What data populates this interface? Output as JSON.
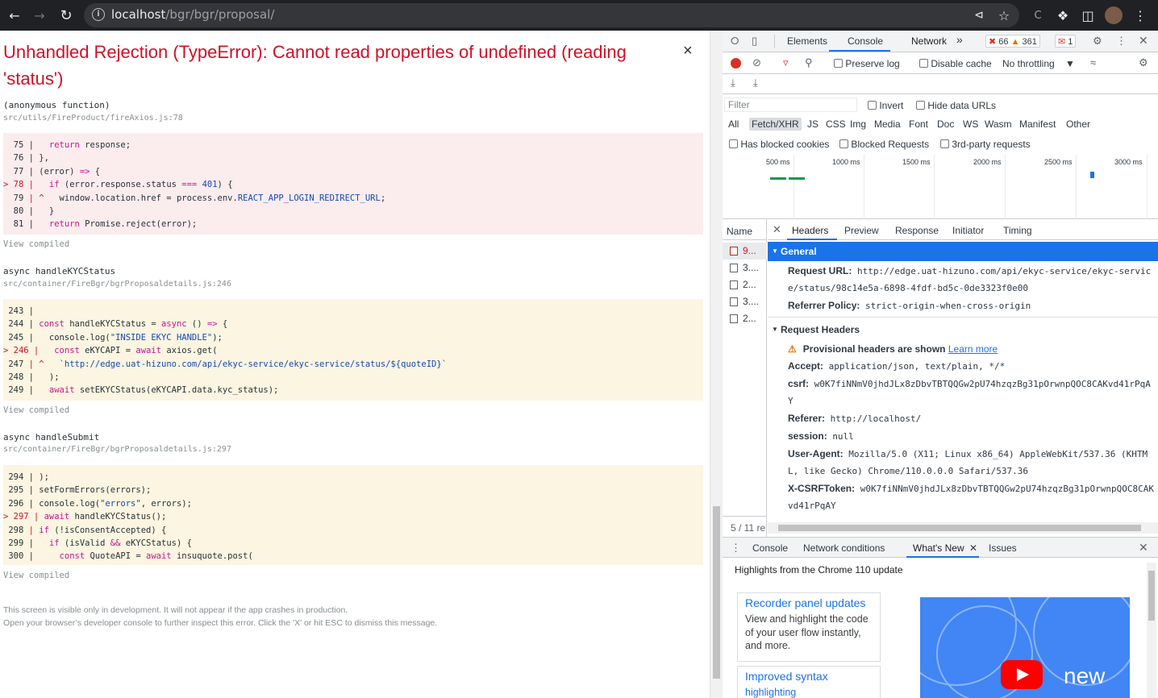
{
  "browser": {
    "url_host": "localhost",
    "url_path": "/bgr/bgr/proposal/"
  },
  "error_overlay": {
    "title": "Unhandled Rejection (TypeError): Cannot read properties of undefined (reading 'status')",
    "close_label": "×",
    "frames": [
      {
        "function": "(anonymous function)",
        "file": "src/utils/FireProduct/fireAxios.js:78",
        "view_compiled": "View compiled"
      },
      {
        "function": "async handleKYCStatus",
        "file": "src/container/FireBgr/bgrProposaldetails.js:246",
        "view_compiled": "View compiled"
      },
      {
        "function": "async handleSubmit",
        "file": "src/container/FireBgr/bgrProposaldetails.js:297",
        "view_compiled": "View compiled"
      }
    ],
    "footnote_line1": "This screen is visible only in development. It will not appear if the app crashes in production.",
    "footnote_line2": "Open your browser’s developer console to further inspect this error.  Click the 'X' or hit ESC to dismiss this message."
  },
  "devtools": {
    "tabs": [
      "Elements",
      "Console",
      "Network"
    ],
    "active_tab": "Network",
    "more_tabs": "»",
    "error_count": "66",
    "warning_count": "361",
    "issue_count": "1",
    "preserve_log": "Preserve log",
    "disable_cache": "Disable cache",
    "throttling": "No throttling",
    "filter_placeholder": "Filter",
    "invert": "Invert",
    "hide_data_urls": "Hide data URLs",
    "filter_types": [
      "All",
      "Fetch/XHR",
      "JS",
      "CSS",
      "Img",
      "Media",
      "Font",
      "Doc",
      "WS",
      "Wasm",
      "Manifest",
      "Other"
    ],
    "selected_filter": "Fetch/XHR",
    "has_blocked_cookies": "Has blocked cookies",
    "blocked_requests": "Blocked Requests",
    "third_party": "3rd-party requests",
    "timeline_labels": [
      "500 ms",
      "1000 ms",
      "1500 ms",
      "2000 ms",
      "2500 ms",
      "3000 ms"
    ],
    "name_header": "Name",
    "requests": [
      "9...",
      "3....",
      "2...",
      "3....",
      "2..."
    ],
    "status_text": "5 / 11 re",
    "detail_tabs": [
      "Headers",
      "Preview",
      "Response",
      "Initiator",
      "Timing"
    ],
    "general": {
      "title": "General",
      "request_url_label": "Request URL:",
      "request_url": "http://edge.uat-hizuno.com/api/ekyc-service/ekyc-service/status/98c14e5a-6898-4fdf-bd5c-0de3323f0e00",
      "referrer_policy_label": "Referrer Policy:",
      "referrer_policy": "strict-origin-when-cross-origin"
    },
    "request_headers": {
      "title": "Request Headers",
      "provisional": "Provisional headers are shown",
      "learn_more": "Learn more",
      "items": [
        {
          "k": "Accept:",
          "v": "application/json, text/plain, */*"
        },
        {
          "k": "csrf:",
          "v": "w0K7fiNNmV0jhdJLx8zDbvTBTQQGw2pU74hzqzBg31pOrwnpQOC8CAKvd41rPqAY"
        },
        {
          "k": "Referer:",
          "v": "http://localhost/"
        },
        {
          "k": "session:",
          "v": "null"
        },
        {
          "k": "User-Agent:",
          "v": "Mozilla/5.0 (X11; Linux x86_64) AppleWebKit/537.36 (KHTML, like Gecko) Chrome/110.0.0.0 Safari/537.36"
        },
        {
          "k": "X-CSRFToken:",
          "v": "w0K7fiNNmV0jhdJLx8zDbvTBTQQGw2pU74hzqzBg31pOrwnpQOC8CAKvd41rPqAY"
        }
      ]
    },
    "drawer_tabs": [
      "Console",
      "Network conditions",
      "What's New",
      "Issues"
    ],
    "drawer_active": "What's New",
    "highlights_title": "Highlights from the Chrome 110 update",
    "cards": [
      {
        "title": "Recorder panel updates",
        "desc": "View and highlight the code of your user flow instantly, and more."
      },
      {
        "title": "Improved syntax",
        "desc": "highlighting"
      }
    ],
    "promo_text": "new"
  }
}
